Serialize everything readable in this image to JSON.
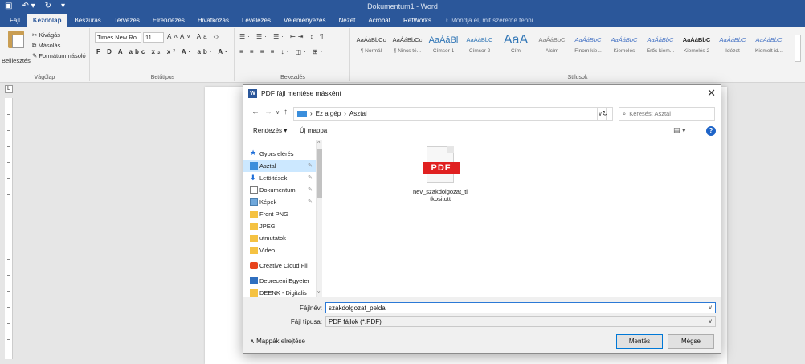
{
  "window": {
    "title": "Dokumentum1 - Word"
  },
  "tabs": [
    "Fájl",
    "Kezdőlap",
    "Beszúrás",
    "Tervezés",
    "Elrendezés",
    "Hivatkozás",
    "Levelezés",
    "Véleményezés",
    "Nézet",
    "Acrobat",
    "RefWorks"
  ],
  "tell_me": "Mondja el, mit szeretne tenni...",
  "ribbon": {
    "clipboard": {
      "paste": "Beillesztés",
      "cut": "Kivágás",
      "copy": "Másolás",
      "format_painter": "Formátummásoló",
      "label": "Vágólap"
    },
    "font": {
      "name": "Times New Ro",
      "size": "11",
      "label": "Betűtípus"
    },
    "paragraph": {
      "label": "Bekezdés"
    },
    "styles": {
      "label": "Stílusok",
      "items": [
        {
          "preview": "AaÁáBbCc",
          "name": "¶ Normál"
        },
        {
          "preview": "AaÁáBbCc",
          "name": "¶ Nincs té..."
        },
        {
          "preview": "AaÁáBl",
          "name": "Címsor 1"
        },
        {
          "preview": "AaÁáBbC",
          "name": "Címsor 2"
        },
        {
          "preview": "AaA",
          "name": "Cím"
        },
        {
          "preview": "AaÁáBbC",
          "name": "Alcím"
        },
        {
          "preview": "AaÁáBbC",
          "name": "Finom kie..."
        },
        {
          "preview": "AaÁáBbC",
          "name": "Kiemelés"
        },
        {
          "preview": "AaÁáBbC",
          "name": "Erős kiem..."
        },
        {
          "preview": "AaÁáBbC",
          "name": "Kiemelés 2"
        },
        {
          "preview": "AaÁáBbC",
          "name": "Idézet"
        },
        {
          "preview": "AaÁáBbC",
          "name": "Kiemelt id..."
        }
      ]
    }
  },
  "dialog": {
    "title": "PDF fájl mentése másként",
    "address": {
      "crumbs": [
        "›",
        "Ez a gép",
        "›",
        "Asztal"
      ]
    },
    "search_placeholder": "Keresés: Asztal",
    "toolbar": {
      "organize": "Rendezés ▾",
      "new_folder": "Új mappa"
    },
    "nav": [
      {
        "label": "Gyors elérés",
        "icon": "star-icon"
      },
      {
        "label": "Asztal",
        "icon": "desktop-icon",
        "selected": true,
        "pinned": true
      },
      {
        "label": "Letöltések",
        "icon": "download-icon",
        "pinned": true
      },
      {
        "label": "Dokumentum",
        "icon": "document-icon",
        "pinned": true
      },
      {
        "label": "Képek",
        "icon": "pictures-icon",
        "pinned": true
      },
      {
        "label": "Front PNG",
        "icon": "folder-icon"
      },
      {
        "label": "JPEG",
        "icon": "folder-icon"
      },
      {
        "label": "utmutatok",
        "icon": "folder-icon"
      },
      {
        "label": "Video",
        "icon": "folder-icon"
      },
      {
        "label": "Creative Cloud Fil",
        "icon": "creative-cloud-icon"
      },
      {
        "label": "Debreceni Egyeter",
        "icon": "network-icon"
      },
      {
        "label": "DEENK - Digitalis",
        "icon": "folder-icon"
      }
    ],
    "file": {
      "badge": "PDF",
      "name": "nev_szakdolgozat_titkositott"
    },
    "filename_label": "Fájlnév:",
    "filename_value": "szakdolgozat_pelda",
    "filetype_label": "Fájl típusa:",
    "filetype_value": "PDF fájlok (*.PDF)",
    "hide_folders": "Mappák elrejtése",
    "save": "Mentés",
    "cancel": "Mégse"
  }
}
